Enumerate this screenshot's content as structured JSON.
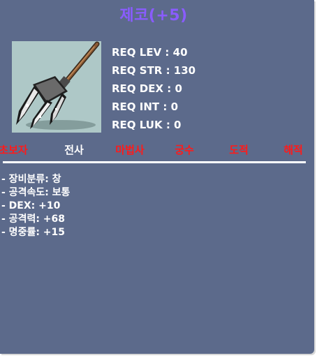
{
  "item": {
    "name": "제코(+5)",
    "name_color": "#8a5cff",
    "icon": "trident-spear-icon"
  },
  "requirements": [
    "REQ LEV : 40",
    "REQ STR : 130",
    "REQ DEX : 0",
    "REQ INT : 0",
    "REQ LUK : 0"
  ],
  "jobs": [
    {
      "label": "초보자",
      "color": "#ff1a1a"
    },
    {
      "label": "전사",
      "color": "#ffffff"
    },
    {
      "label": "마법사",
      "color": "#ff1a1a"
    },
    {
      "label": "궁수",
      "color": "#ff1a1a"
    },
    {
      "label": "도적",
      "color": "#ff1a1a"
    },
    {
      "label": "해적",
      "color": "#ff1a1a"
    }
  ],
  "stats": [
    "- 장비분류: 창",
    "- 공격속도: 보통",
    "- DEX: +10",
    "- 공격력: +68",
    "- 명중률: +15"
  ],
  "colors": {
    "panel_bg": "#5c6a8b",
    "icon_bg": "#aec8c7",
    "allowed_job": "#ffffff",
    "disallowed_job": "#ff1a1a"
  }
}
